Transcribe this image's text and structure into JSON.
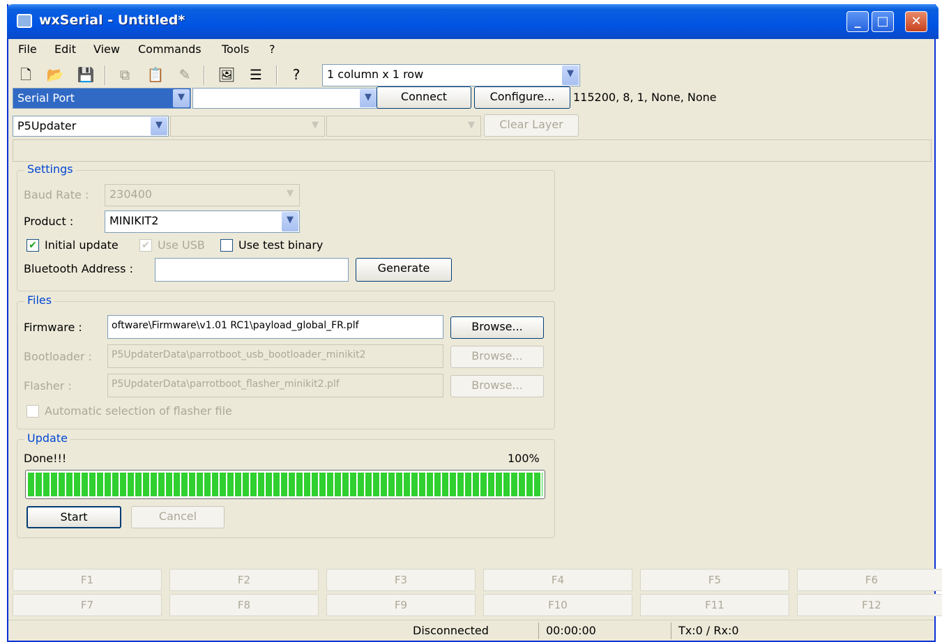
{
  "window": {
    "title": "wxSerial - Untitled*",
    "minimize": "_",
    "maximize": "□",
    "close": "✕"
  },
  "menu": [
    "File",
    "Edit",
    "View",
    "Commands",
    "Tools",
    "?"
  ],
  "toolbar": {
    "layout_select": "1 column x 1 row"
  },
  "connection": {
    "port_type": "Serial Port",
    "port": "",
    "connect_label": "Connect",
    "configure_label": "Configure...",
    "settings_text": "115200, 8, 1, None, None"
  },
  "layer": {
    "protocol": "P5Updater",
    "sub1": "",
    "sub2": "",
    "clear_label": "Clear Layer"
  },
  "settings": {
    "title": "Settings",
    "baud_label": "Baud Rate :",
    "baud_value": "230400",
    "product_label": "Product :",
    "product_value": "MINIKIT2",
    "initial_update_label": "Initial update",
    "initial_update_checked": true,
    "use_usb_label": "Use USB",
    "use_usb_checked": true,
    "use_test_binary_label": "Use test binary",
    "use_test_binary_checked": false,
    "bt_label": "Bluetooth Address :",
    "bt_value": "",
    "generate_label": "Generate"
  },
  "files": {
    "title": "Files",
    "firmware_label": "Firmware :",
    "firmware_value": "oftware\\Firmware\\v1.01 RC1\\payload_global_FR.plf",
    "bootloader_label": "Bootloader :",
    "bootloader_value": "P5UpdaterData\\parrotboot_usb_bootloader_minikit2",
    "flasher_label": "Flasher :",
    "flasher_value": "P5UpdaterData\\parrotboot_flasher_minikit2.plf",
    "browse_label": "Browse...",
    "auto_label": "Automatic selection of flasher file"
  },
  "update": {
    "title": "Update",
    "status": "Done!!!",
    "percent_text": "100%",
    "progress": 1.0,
    "start_label": "Start",
    "cancel_label": "Cancel"
  },
  "fkeys": [
    "F1",
    "F2",
    "F3",
    "F4",
    "F5",
    "F6",
    "F7",
    "F8",
    "F9",
    "F10",
    "F11",
    "F12"
  ],
  "status": {
    "connection": "Disconnected",
    "time": "00:00:00",
    "counters": "Tx:0 / Rx:0"
  },
  "colors": {
    "titlebar": "#0054e3",
    "progress": "#2fd02f",
    "window_bg": "#ece9d8"
  }
}
